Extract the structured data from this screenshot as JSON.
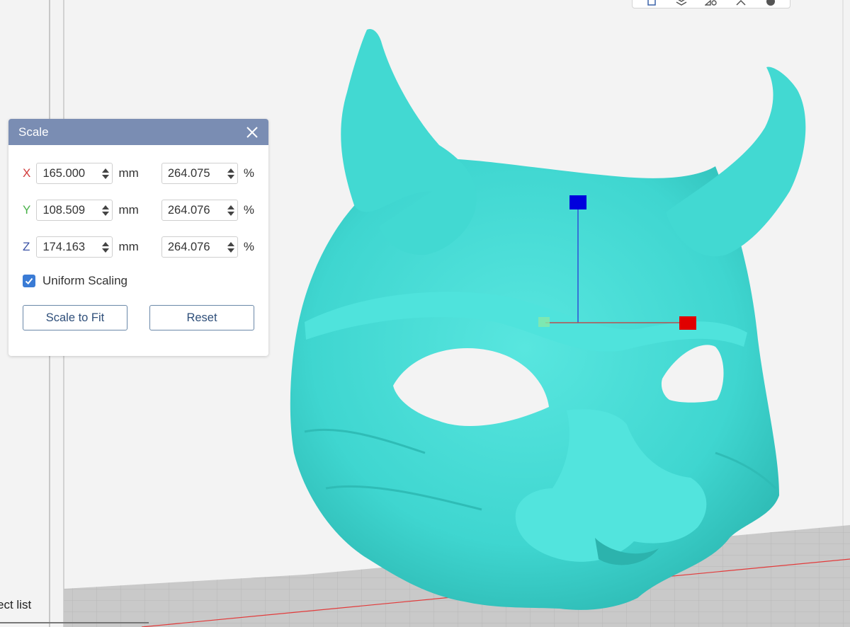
{
  "toolbar": {
    "icons": [
      "cube-icon",
      "layers-icon",
      "view-icon",
      "arrange-icon",
      "help-icon"
    ]
  },
  "scale_panel": {
    "title": "Scale",
    "rows": [
      {
        "axis": "X",
        "axis_color": "#d23c3c",
        "mm": "165.000",
        "mm_unit": "mm",
        "pct": "264.075",
        "pct_unit": "%"
      },
      {
        "axis": "Y",
        "axis_color": "#49b24a",
        "mm": "108.509",
        "mm_unit": "mm",
        "pct": "264.076",
        "pct_unit": "%"
      },
      {
        "axis": "Z",
        "axis_color": "#3a52a5",
        "mm": "174.163",
        "mm_unit": "mm",
        "pct": "264.076",
        "pct_unit": "%"
      }
    ],
    "uniform_scaling_label": "Uniform Scaling",
    "uniform_scaling_checked": true,
    "scale_to_fit_label": "Scale to Fit",
    "reset_label": "Reset"
  },
  "object_list_label": "ect list",
  "colors": {
    "model": "#3fd6d0",
    "panel_header": "#7a8db3",
    "accent": "#3a7bd5",
    "gizmo_x": "#e00000",
    "gizmo_y": "#88e8a8",
    "gizmo_z": "#0000dd"
  }
}
